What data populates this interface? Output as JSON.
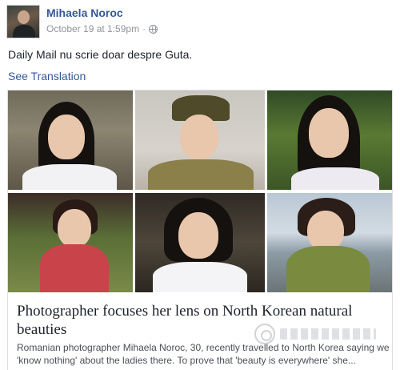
{
  "post": {
    "author": "Mihaela Noroc",
    "timestamp": "October 19 at 1:59pm",
    "separator": "·",
    "privacy_icon": "globe-icon",
    "text": "Daily Mail nu scrie doar despre Guta.",
    "see_translation": "See Translation"
  },
  "link_card": {
    "headline": "Photographer focuses her lens on North Korean natural beauties",
    "description": "Romanian photographer Mihaela Noroc, 30, recently travelled to North Korea saying we 'know nothing' about the ladies there. To prove that 'beauty is everywhere' she...",
    "photos": [
      {
        "id": "portrait-1"
      },
      {
        "id": "portrait-2"
      },
      {
        "id": "portrait-3"
      },
      {
        "id": "portrait-4"
      },
      {
        "id": "portrait-5"
      },
      {
        "id": "portrait-6"
      }
    ]
  },
  "colors": {
    "link": "#365899",
    "text": "#1d2129",
    "meta": "#90949c",
    "border": "#dddfe2"
  }
}
